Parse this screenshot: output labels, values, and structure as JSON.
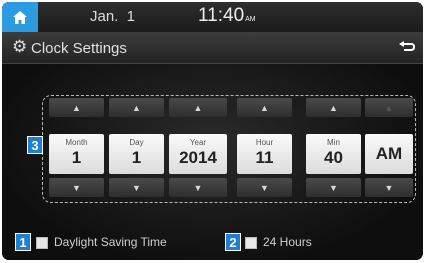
{
  "status": {
    "date": "Jan.  1",
    "time": "11:40",
    "time_suffix": "AM"
  },
  "header": {
    "title": "Clock Settings"
  },
  "picker": {
    "columns": [
      {
        "label": "Month",
        "value": "1"
      },
      {
        "label": "Day",
        "value": "1"
      },
      {
        "label": "Year",
        "value": "2014"
      },
      {
        "label": "Hour",
        "value": "11"
      },
      {
        "label": "Min",
        "value": "40"
      },
      {
        "label": "",
        "value": "AM"
      }
    ]
  },
  "badges": {
    "daylight": "1",
    "hours24": "2",
    "picker": "3"
  },
  "options": {
    "daylight_saving": {
      "label": "Daylight Saving Time",
      "checked": false
    },
    "hours_24": {
      "label": "24 Hours",
      "checked": false
    }
  },
  "icons": {
    "home": "home-icon",
    "gear": "gear-icon",
    "back": "back-icon",
    "up": "arrow-up-icon",
    "down": "arrow-down-icon"
  },
  "colors": {
    "accent": "#2d9be0",
    "badge": "#1e7fd0"
  }
}
